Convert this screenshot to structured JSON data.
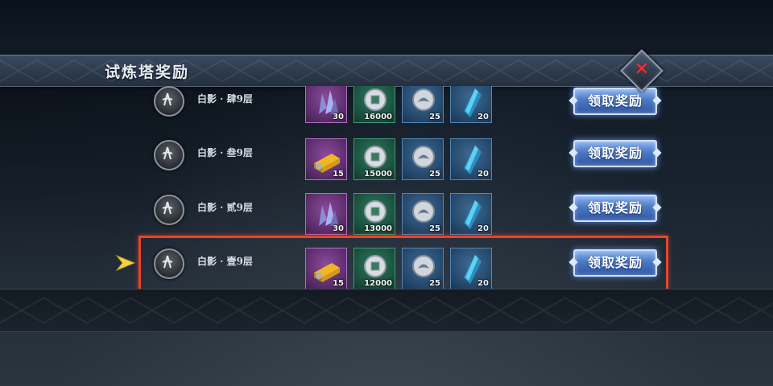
{
  "panel": {
    "title": "试炼塔奖励",
    "close_icon": "close-x-icon"
  },
  "rows": [
    {
      "label": "白影 · 肆9层",
      "rewards": [
        {
          "icon": "purple-crystal-icon",
          "rarity": "purple",
          "count": "30"
        },
        {
          "icon": "silver-coin-icon",
          "rarity": "green",
          "count": "16000"
        },
        {
          "icon": "lotus-token-icon",
          "rarity": "blue",
          "count": "25"
        },
        {
          "icon": "blue-shard-icon",
          "rarity": "blue",
          "count": "20"
        }
      ],
      "button": "领取奖励",
      "current": false
    },
    {
      "label": "白影 · 叁9层",
      "rewards": [
        {
          "icon": "gold-bar-icon",
          "rarity": "purple",
          "count": "15"
        },
        {
          "icon": "silver-coin-icon",
          "rarity": "green",
          "count": "15000"
        },
        {
          "icon": "lotus-token-icon",
          "rarity": "blue",
          "count": "25"
        },
        {
          "icon": "blue-shard-icon",
          "rarity": "blue",
          "count": "20"
        }
      ],
      "button": "领取奖励",
      "current": false
    },
    {
      "label": "白影 · 贰9层",
      "rewards": [
        {
          "icon": "purple-crystal-icon",
          "rarity": "purple",
          "count": "30"
        },
        {
          "icon": "silver-coin-icon",
          "rarity": "green",
          "count": "13000"
        },
        {
          "icon": "lotus-token-icon",
          "rarity": "blue",
          "count": "25"
        },
        {
          "icon": "blue-shard-icon",
          "rarity": "blue",
          "count": "20"
        }
      ],
      "button": "领取奖励",
      "current": false
    },
    {
      "label": "白影 · 壹9层",
      "rewards": [
        {
          "icon": "gold-bar-icon",
          "rarity": "purple",
          "count": "15"
        },
        {
          "icon": "silver-coin-icon",
          "rarity": "green",
          "count": "12000"
        },
        {
          "icon": "lotus-token-icon",
          "rarity": "blue",
          "count": "25"
        },
        {
          "icon": "blue-shard-icon",
          "rarity": "blue",
          "count": "20"
        }
      ],
      "button": "领取奖励",
      "current": true
    }
  ],
  "colors": {
    "highlight": "#e8452a",
    "current_arrow": "#f5d442",
    "button_blue": "#4c78c4"
  }
}
